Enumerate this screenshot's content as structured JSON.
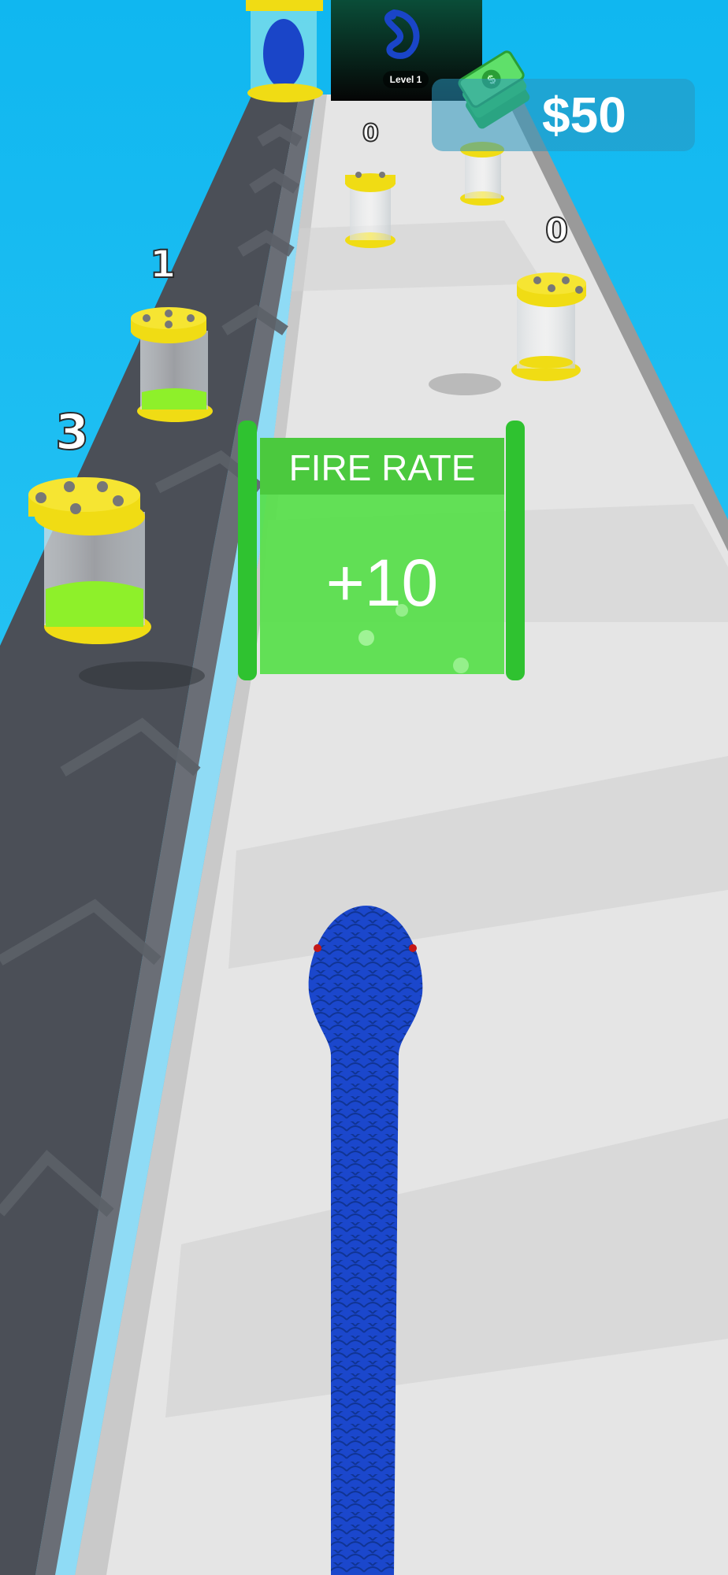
{
  "hud": {
    "level_label": "Level 1",
    "money": "$50",
    "boss_icon": "snake-icon",
    "cash_icon": "money-bills-icon"
  },
  "track": {
    "left_conveyor_capsules": [
      {
        "count": "1",
        "fill_level": 0.35
      },
      {
        "count": "3",
        "fill_level": 0.45
      }
    ],
    "right_capsules": [
      {
        "count": "0",
        "fill_level": 0.0
      },
      {
        "count": "0",
        "fill_level": 0.05
      }
    ]
  },
  "gate": {
    "title": "FIRE RATE",
    "value": "+10",
    "color": "#57e04a"
  },
  "colors": {
    "sky": "#1ec6f5",
    "conveyor": "#4c5058",
    "road": "#e4e4e4",
    "snake": "#1a45c8",
    "capsule_cap": "#f0dc14",
    "liquid": "#8ef02a"
  }
}
